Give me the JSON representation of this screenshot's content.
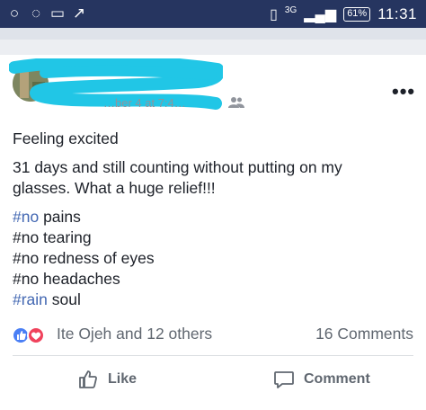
{
  "status_bar": {
    "icons": [
      "notification-icon",
      "whatsapp-icon",
      "message-icon",
      "missed-call-icon"
    ],
    "network_label": "3G",
    "battery_percent": "61%",
    "time": "11:31"
  },
  "post": {
    "meta_text": "…ber 4 at 7:4…",
    "audience": "friends-icon",
    "more_icon": "•••",
    "lines": {
      "feeling": "Feeling excited",
      "body_line1": "31 days and still counting without putting on my",
      "body_line2": "glasses. What a huge relief!!!",
      "h1_tag": "#no",
      "h1_rest": " pains",
      "h2": "#no tearing",
      "h3": "#no redness of eyes",
      "h4": "#no headaches",
      "h5_tag": "#rain",
      "h5_rest": " soul"
    },
    "reactions": {
      "names": "Ite Ojeh and 12 others",
      "comments": "16 Comments"
    },
    "actions": {
      "like_label": "Like",
      "comment_label": "Comment"
    }
  },
  "colors": {
    "status_bar": "#263560",
    "link": "#4267b2",
    "like_blue": "#4a7ff5",
    "love_red": "#f0425c"
  }
}
